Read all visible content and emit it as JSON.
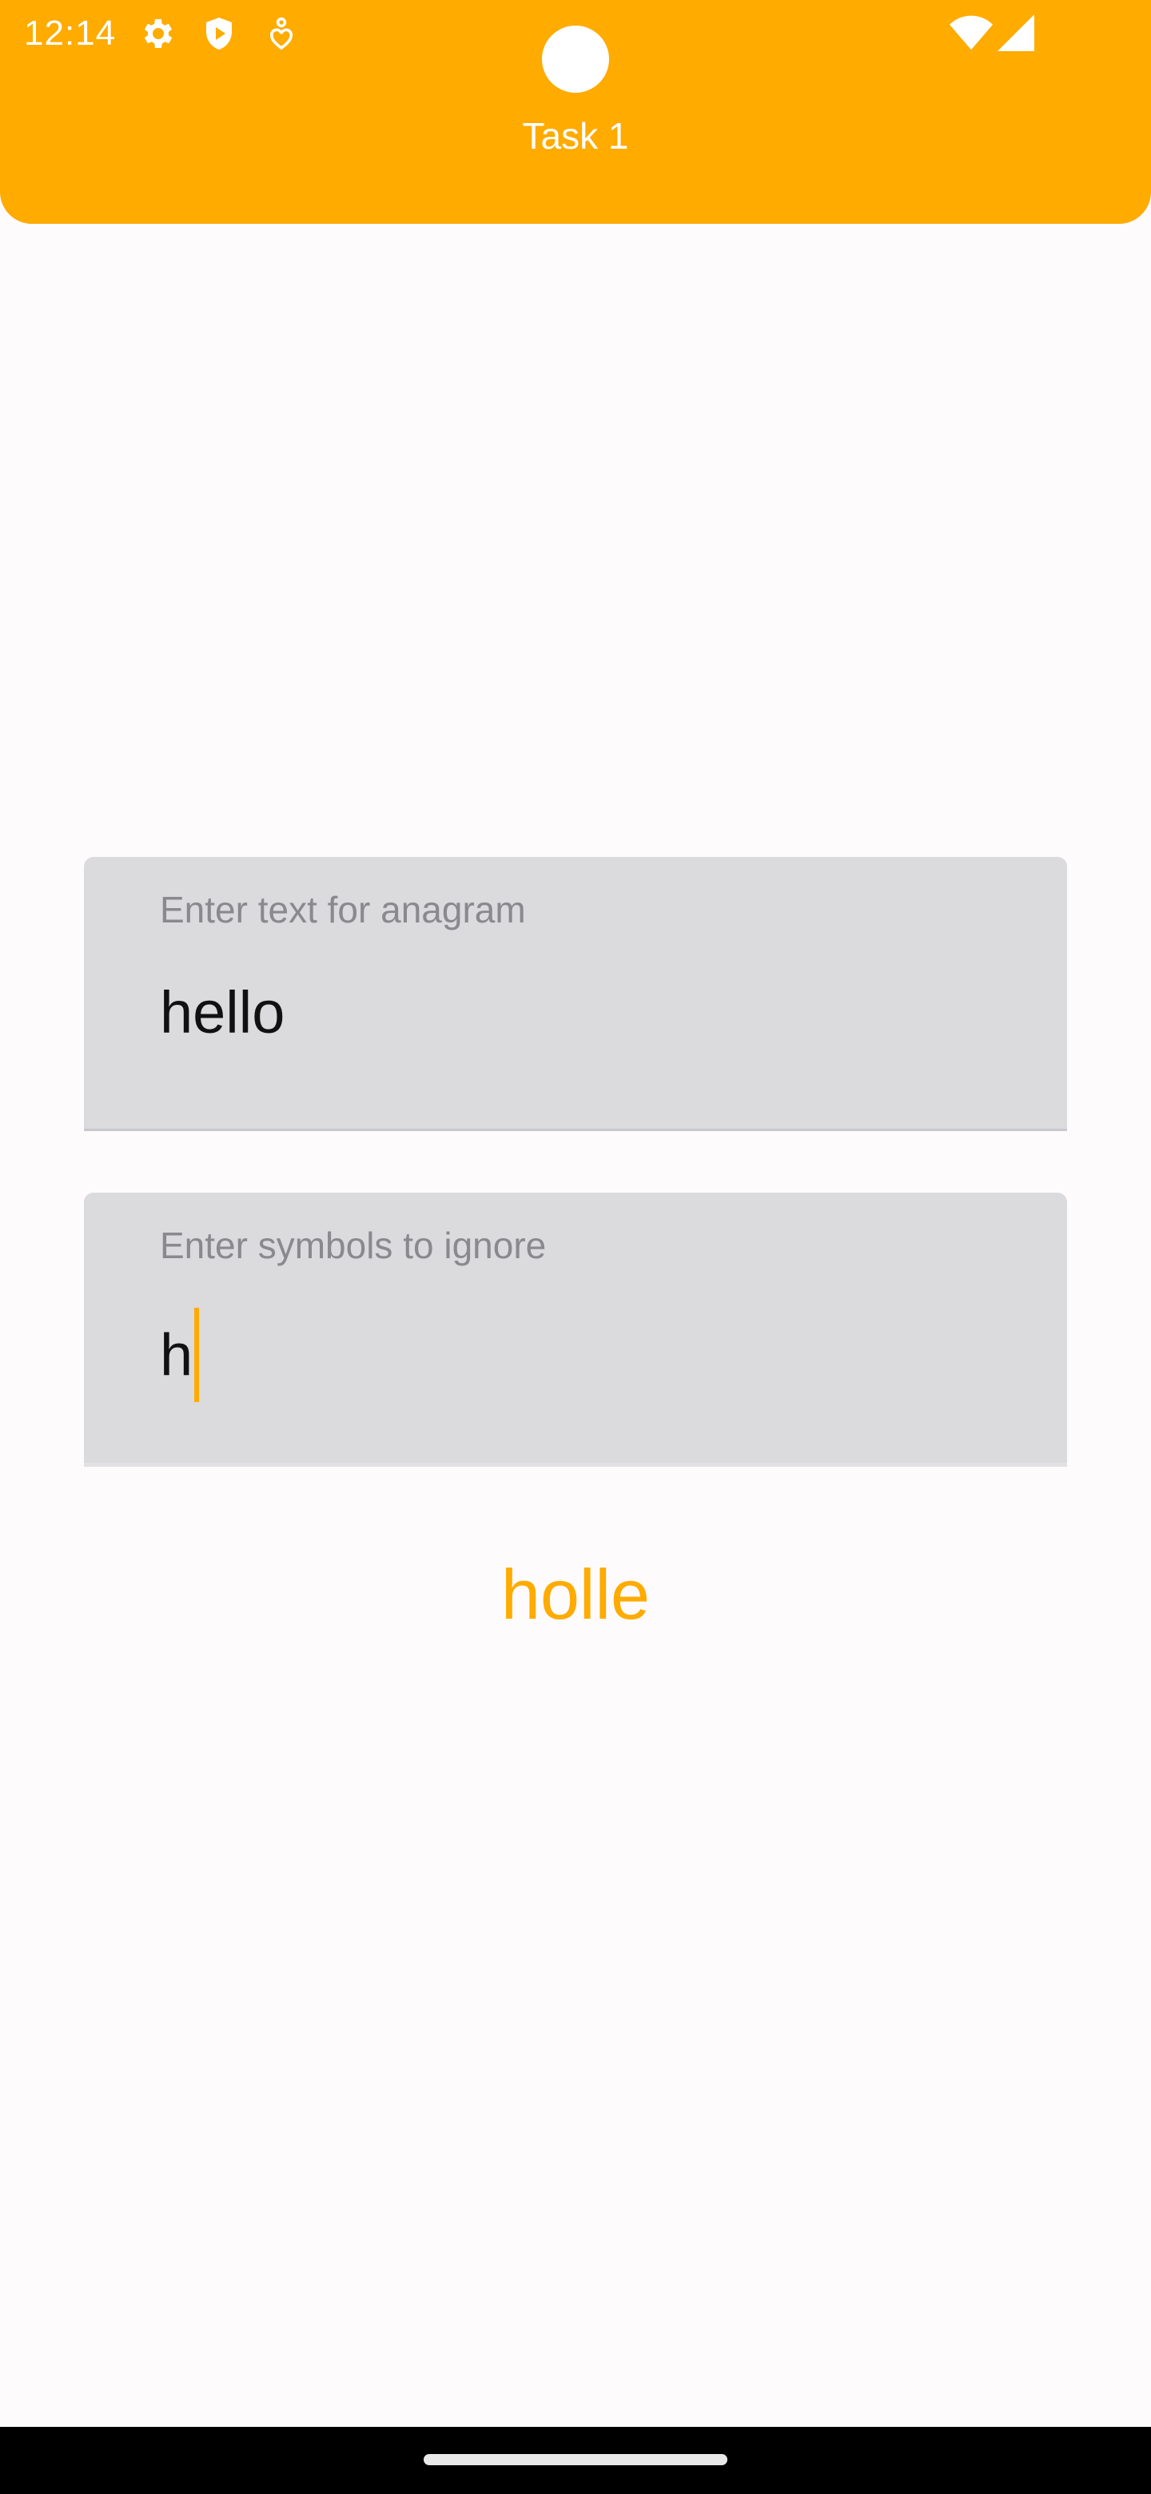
{
  "status_bar": {
    "time": "12:14",
    "icons": [
      "gear-icon",
      "shield-play-icon",
      "location-heart-icon",
      "wifi-icon",
      "signal-icon"
    ]
  },
  "app_bar": {
    "title": "Task 1",
    "color": "#ffab00"
  },
  "form": {
    "text_field": {
      "label": "Enter text for anagram",
      "value": "hello"
    },
    "ignore_field": {
      "label": "Enter symbols to ignore",
      "value": "h"
    }
  },
  "result": {
    "text": "holle",
    "color": "#ffab00"
  }
}
